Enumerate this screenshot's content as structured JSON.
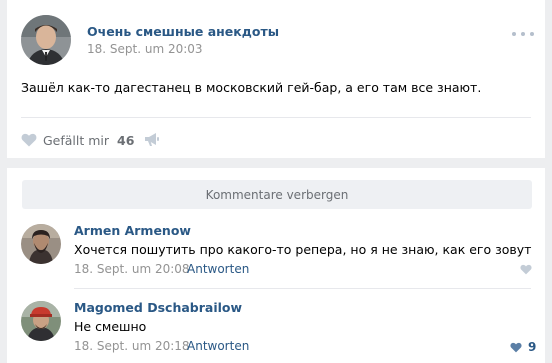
{
  "post": {
    "author": "Очень смешные анекдоты",
    "date": "18. Sept. um 20:03",
    "text": "Зашёл как-то дагестанец в московский гей-бар, а его там все знают.",
    "like_label": "Gefällt mir",
    "like_count": "46"
  },
  "comments_toggle": "Kommentare verbergen",
  "comments": [
    {
      "author": "Armen Armenow",
      "text": "Хочется пошутить про какого-то репера, но я не знаю, как его зовут",
      "date": "18. Sept. um 20:08",
      "reply_label": "Antworten",
      "like_count": ""
    },
    {
      "author": "Magomed Dschabrailow",
      "text": "Не смешно",
      "date": "18. Sept. um 20:18",
      "reply_label": "Antworten",
      "like_count": "9"
    }
  ],
  "colors": {
    "link": "#2a5885",
    "muted": "#939393",
    "like_icon": "#c3ccd6",
    "liked_icon": "#5b7fa6"
  }
}
